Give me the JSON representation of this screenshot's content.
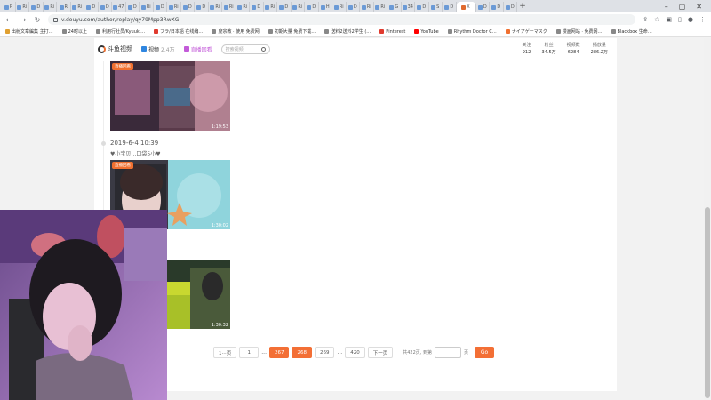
{
  "browser": {
    "tab_labels": [
      "P",
      "Ri",
      "D",
      "Ri",
      "R",
      "Ri",
      "D",
      "D",
      "47",
      "D",
      "Ri",
      "D",
      "Ri",
      "D",
      "D",
      "Ri",
      "Ri",
      "Ri",
      "D",
      "Ri",
      "D",
      "Ri",
      "D",
      "H",
      "Ri",
      "D",
      "Ri",
      "Ri",
      "G",
      "34",
      "D",
      "S",
      "D",
      "X",
      "D",
      "D",
      "D"
    ],
    "new_tab": "+",
    "window_controls": [
      "–",
      "▢",
      "✕"
    ],
    "url": "v.douyu.com/author/replay/qy79Mpp3RwXG",
    "bookmarks": [
      "出射文章編集 主打…",
      "24时以上",
      "利用行社员/Kyuuki…",
      "プラ/日本語 在线编…",
      "度宗教 · 使用 免费网",
      "初期大量 免费下载…",
      "送料2送料2学生 (…",
      "Pinterest",
      "YouTube",
      "Rhythm Doctor C…",
      "ナイアゲーマスク",
      "漫画网站 · 免费网…",
      "Blackbox 生命…"
    ]
  },
  "site": {
    "logo_text": "斗鱼视频",
    "nav_video": "视频",
    "nav_video_sub": "2.4万",
    "nav_live": "直播回看",
    "search_placeholder": "搜索视频",
    "stats": [
      {
        "label": "关注",
        "value": "912"
      },
      {
        "label": "粉丝",
        "value": "34.5万"
      },
      {
        "label": "视频数",
        "value": "6284"
      },
      {
        "label": "播放量",
        "value": "286.2万"
      }
    ]
  },
  "posts": [
    {
      "badge": "直播回看",
      "duration": "1:19:53"
    },
    {
      "date": "2019-6-4 10:39",
      "text": "♥小宝贝…口袋5小♥",
      "badge": "直播回看",
      "duration": "1:30:02"
    },
    {
      "duration": "1:30:32"
    }
  ],
  "pagination": {
    "first": "1···页",
    "page_1": "1",
    "ellipsis_1": "...",
    "page_prev": "267",
    "page_current": "268",
    "page_next": "269",
    "ellipsis_2": "...",
    "last": "420",
    "next": "下一页",
    "total_text": "共422页, 到第",
    "page_suffix": "页",
    "go": "Go"
  },
  "colors": {
    "accent": "#f36f35",
    "live_purple": "#c35bd9",
    "link_blue": "#2f86e0"
  }
}
